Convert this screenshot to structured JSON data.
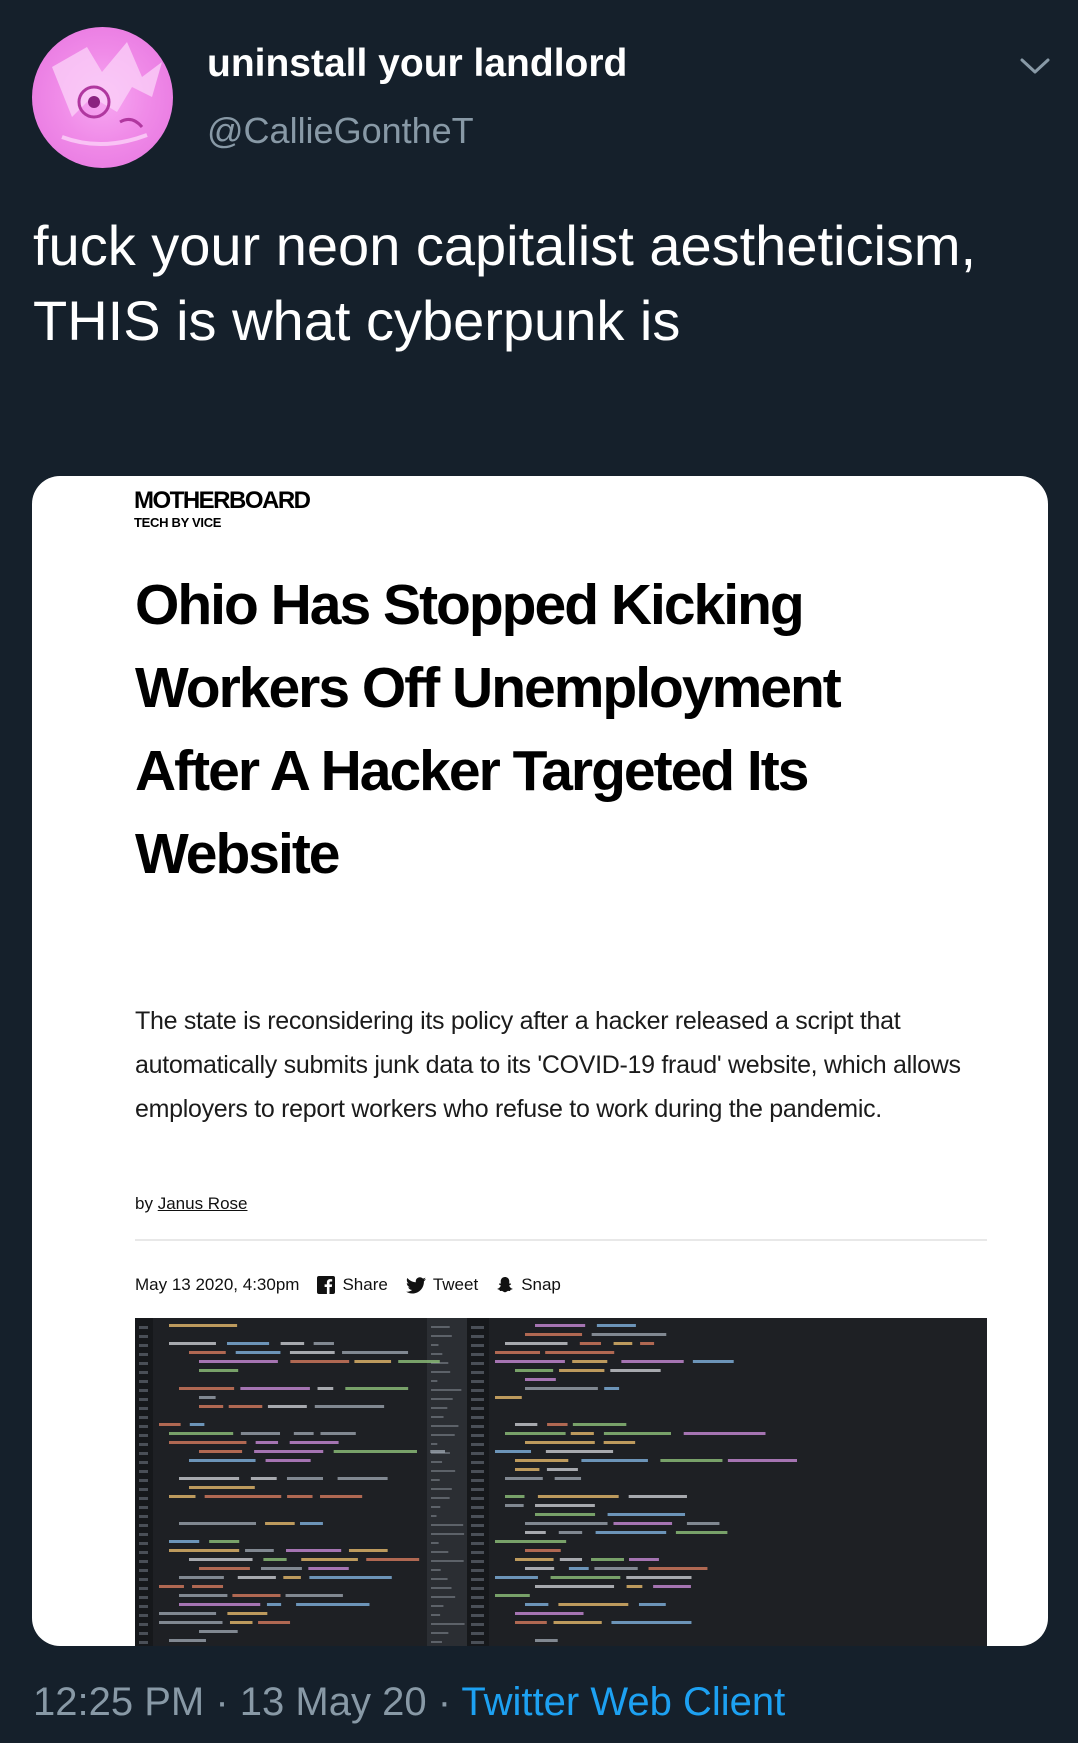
{
  "tweet": {
    "display_name": "uninstall your landlord",
    "handle": "@CallieGontheT",
    "text": "fuck your neon capitalist aestheticism, THIS is what cyberpunk is",
    "time": "12:25 PM",
    "date": "13 May 20",
    "separator": "·",
    "client": "Twitter Web Client",
    "menu_icon": "chevron-down-icon"
  },
  "article": {
    "brand": "MOTHERBOARD",
    "brand_sub": "TECH BY VICE",
    "headline": "Ohio Has Stopped Kicking Workers Off Unemployment After A Hacker Targeted Its Website",
    "dek": "The state is reconsidering its policy after a hacker released a script that automatically submits junk data to its 'COVID-19 fraud' website, which allows employers to report workers who refuse to work during the pandemic.",
    "byline_prefix": "by",
    "author": "Janus Rose",
    "published": "May 13 2020, 4:30pm",
    "share_label": "Share",
    "tweet_label": "Tweet",
    "snap_label": "Snap"
  },
  "colors": {
    "background": "#15202b",
    "secondary_text": "#8899a6",
    "link": "#1da1f2",
    "avatar": "#f08be8"
  }
}
